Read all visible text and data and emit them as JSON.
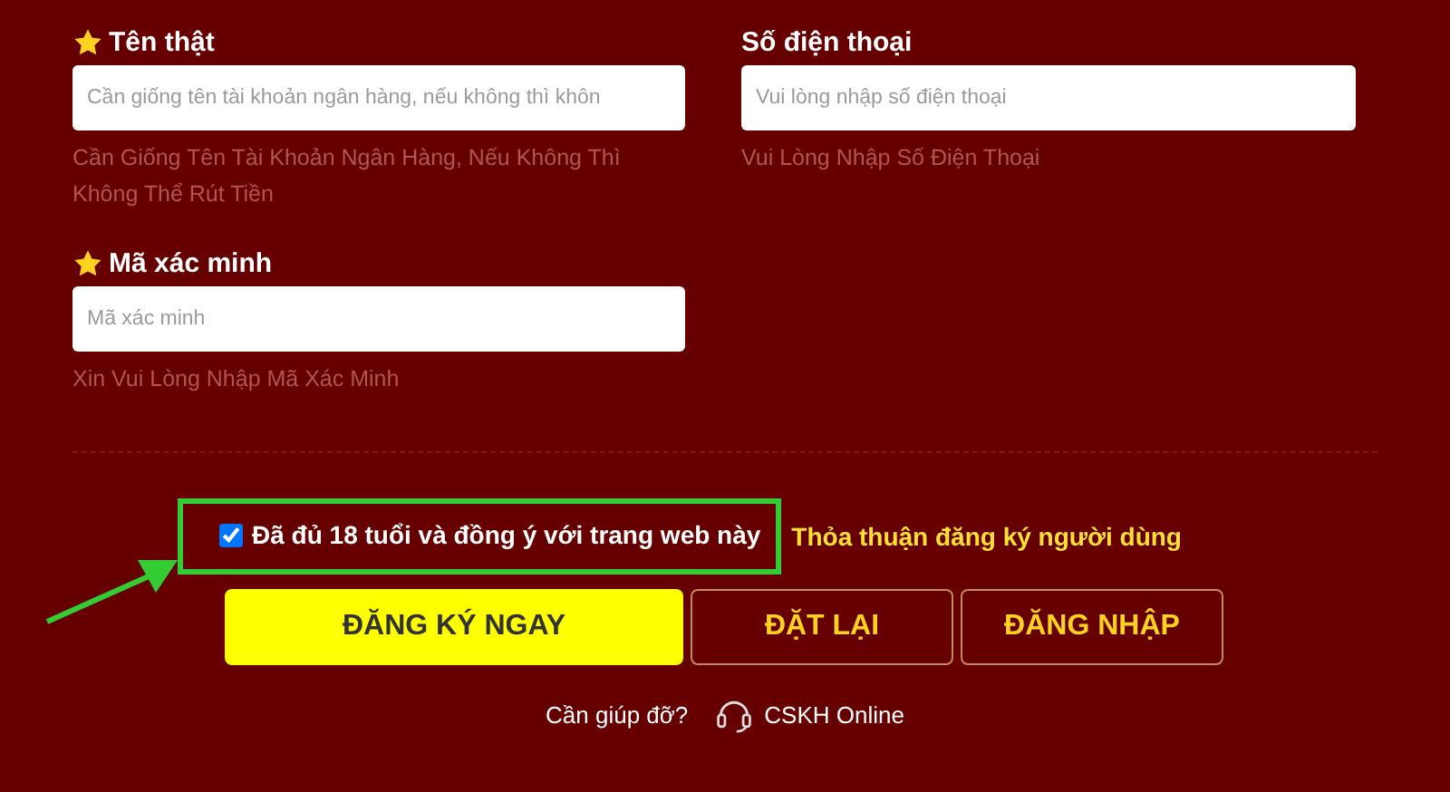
{
  "fields": [
    {
      "label": "Tên thật",
      "required": true,
      "placeholder": "Cần giống tên tài khoản ngân hàng, nếu không thì khôn",
      "hint": "Cần Giống Tên Tài Khoản Ngân Hàng, Nếu Không Thì Không Thể Rút Tiền"
    },
    {
      "label": "Số điện thoại",
      "required": false,
      "placeholder": "Vui lòng nhập số điện thoại",
      "hint": "Vui Lòng Nhập Số Điện Thoại"
    },
    {
      "label": "Mã xác minh",
      "required": true,
      "placeholder": "Mã xác minh",
      "hint": "Xin Vui Lòng Nhập Mã Xác Minh"
    }
  ],
  "agreement": {
    "checked": true,
    "label": "Đã đủ 18 tuổi và đồng ý với trang web này",
    "link": "Thỏa thuận đăng ký người dùng"
  },
  "buttons": [
    {
      "label": "ĐĂNG KÝ NGAY",
      "kind": "primary"
    },
    {
      "label": "ĐẶT LẠI",
      "kind": "outline"
    },
    {
      "label": "ĐĂNG NHẬP",
      "kind": "outline"
    }
  ],
  "help": {
    "question": "Cần giúp đỡ?",
    "contact": "CSKH Online"
  }
}
